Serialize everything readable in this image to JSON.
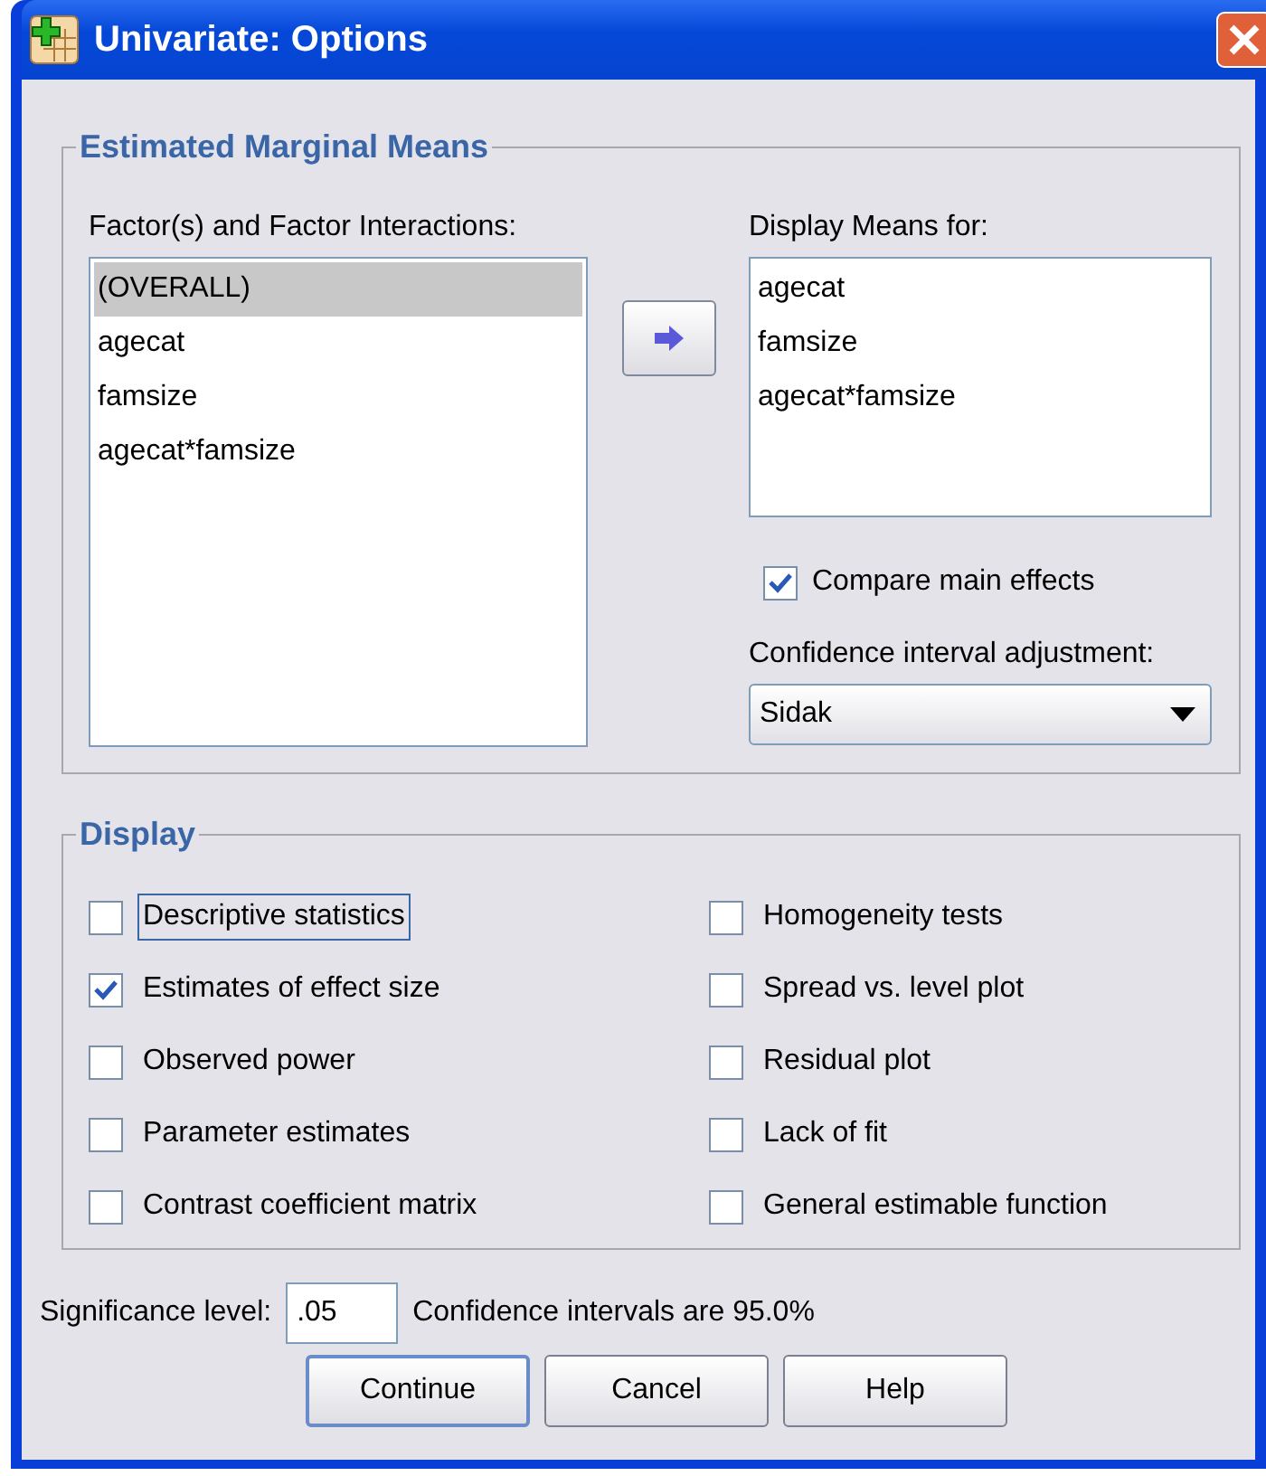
{
  "window": {
    "title": "Univariate: Options"
  },
  "estimated_marginal_means": {
    "title": "Estimated Marginal Means",
    "factors_label": "Factor(s) and Factor Interactions:",
    "factors": [
      {
        "label": "(OVERALL)",
        "selected": true
      },
      {
        "label": "agecat",
        "selected": false
      },
      {
        "label": "famsize",
        "selected": false
      },
      {
        "label": "agecat*famsize",
        "selected": false
      }
    ],
    "display_means_label": "Display Means for:",
    "display_means": [
      {
        "label": "agecat"
      },
      {
        "label": "famsize"
      },
      {
        "label": "agecat*famsize"
      }
    ],
    "compare_main_effects": {
      "label": "Compare main effects",
      "checked": true
    },
    "ci_adjustment_label": "Confidence interval adjustment:",
    "ci_adjustment": {
      "value": "Sidak"
    }
  },
  "display": {
    "title": "Display",
    "options": [
      {
        "label": "Descriptive statistics",
        "checked": false,
        "focused": true
      },
      {
        "label": "Homogeneity tests",
        "checked": false,
        "focused": false
      },
      {
        "label": "Estimates of effect size",
        "checked": true,
        "focused": false
      },
      {
        "label": "Spread vs. level plot",
        "checked": false,
        "focused": false
      },
      {
        "label": "Observed power",
        "checked": false,
        "focused": false
      },
      {
        "label": "Residual plot",
        "checked": false,
        "focused": false
      },
      {
        "label": "Parameter estimates",
        "checked": false,
        "focused": false
      },
      {
        "label": "Lack of fit",
        "checked": false,
        "focused": false
      },
      {
        "label": "Contrast coefficient matrix",
        "checked": false,
        "focused": false
      },
      {
        "label": "General estimable function",
        "checked": false,
        "focused": false
      }
    ]
  },
  "significance": {
    "label": "Significance level:",
    "value": ".05",
    "note": "Confidence intervals are 95.0%"
  },
  "buttons": [
    {
      "label": "Continue",
      "default": true
    },
    {
      "label": "Cancel",
      "default": false
    },
    {
      "label": "Help",
      "default": false
    }
  ]
}
